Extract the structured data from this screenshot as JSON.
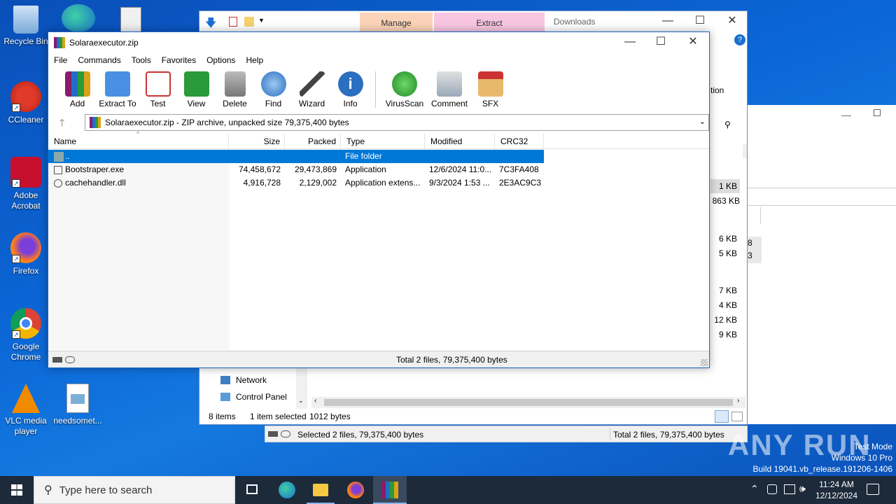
{
  "desktop": {
    "icons": [
      {
        "label": "Recycle Bin"
      },
      {
        "label": "CCleaner"
      },
      {
        "label": "Adobe Acrobat"
      },
      {
        "label": "Firefox"
      },
      {
        "label": "Google Chrome"
      },
      {
        "label": "VLC media player"
      },
      {
        "label": "needsomet..."
      }
    ]
  },
  "explorer": {
    "tab_manage": "Manage",
    "tab_extract": "Extract",
    "title": "Downloads",
    "ribbon_partial": "tion",
    "nav_items": [
      "Network",
      "Control Panel"
    ],
    "sizes": [
      "1 KB",
      "863 KB",
      "6 KB",
      "5 KB",
      "7 KB",
      "4 KB",
      "12 KB",
      "9 KB"
    ],
    "side_marks": [
      "8",
      "3"
    ],
    "status_items": "8 items",
    "status_selected": "1 item selected",
    "status_size": "1012 bytes"
  },
  "rar": {
    "title": "Solaraexecutor.zip",
    "menu": [
      "File",
      "Commands",
      "Tools",
      "Favorites",
      "Options",
      "Help"
    ],
    "toolbar": [
      "Add",
      "Extract To",
      "Test",
      "View",
      "Delete",
      "Find",
      "Wizard",
      "Info",
      "VirusScan",
      "Comment",
      "SFX"
    ],
    "path": "Solaraexecutor.zip - ZIP archive, unpacked size 79,375,400 bytes",
    "columns": [
      "Name",
      "Size",
      "Packed",
      "Type",
      "Modified",
      "CRC32"
    ],
    "rows": [
      {
        "name": "..",
        "size": "",
        "packed": "",
        "type": "File folder",
        "modified": "",
        "crc": ""
      },
      {
        "name": "Bootstraper.exe",
        "size": "74,458,672",
        "packed": "29,473,869",
        "type": "Application",
        "modified": "12/6/2024 11:0...",
        "crc": "7C3FA408"
      },
      {
        "name": "cachehandler.dll",
        "size": "4,916,728",
        "packed": "2,129,002",
        "type": "Application extens...",
        "modified": "9/3/2024 1:53 ...",
        "crc": "2E3AC9C3"
      }
    ],
    "status": "Total 2 files, 79,375,400 bytes"
  },
  "rar2_status": {
    "left": "Selected 2 files, 79,375,400 bytes",
    "right": "Total 2 files, 79,375,400 bytes"
  },
  "watermark": {
    "brand": "ANY RUN",
    "line1": "Test Mode",
    "line2": "Windows 10 Pro",
    "line3": "Build 19041.vb_release.191206-1406"
  },
  "taskbar": {
    "search_placeholder": "Type here to search",
    "time": "11:24 AM",
    "date": "12/12/2024"
  },
  "colors": {
    "selection": "#0078d7",
    "manage_tab": "#fbd3b8",
    "extract_tab": "#f8c6e0"
  }
}
